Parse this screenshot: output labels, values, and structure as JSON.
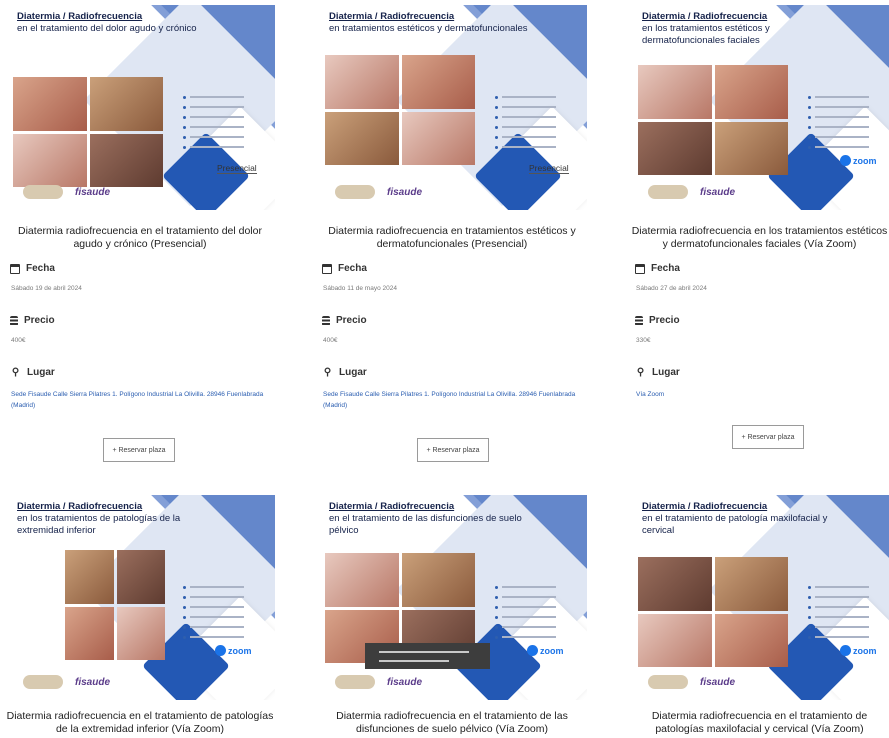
{
  "labels": {
    "fecha": "Fecha",
    "precio": "Precio",
    "lugar": "Lugar",
    "reservar": "+ Reservar plaza"
  },
  "cards": [
    {
      "banner_title": "Diatermia / Radiofrecuencia",
      "banner_sub": "en el tratamiento del dolor agudo y crónico",
      "banner_mode": "Presencial",
      "title": "Diatermia radiofrecuencia en el tratamiento del dolor agudo y crónico (Presencial)",
      "fecha": "Sábado 19 de abril 2024",
      "precio": "400€",
      "lugar": "Sede Fisaude Calle Sierra Pilatres 1. Polígono Industrial La Olivilla. 28946 Fuenlabrada (Madrid)"
    },
    {
      "banner_title": "Diatermia / Radiofrecuencia",
      "banner_sub": "en tratamientos estéticos y dermatofuncionales",
      "banner_mode": "Presencial",
      "title": "Diatermia radiofrecuencia en tratamientos estéticos y dermatofuncionales (Presencial)",
      "fecha": "Sábado 11 de mayo 2024",
      "precio": "400€",
      "lugar": "Sede Fisaude Calle Sierra Pilatres 1. Polígono Industrial La Olivilla. 28946 Fuenlabrada (Madrid)"
    },
    {
      "banner_title": "Diatermia / Radiofrecuencia",
      "banner_sub": "en los tratamientos estéticos y dermatofuncionales faciales",
      "banner_mode": "zoom",
      "title": "Diatermia radiofrecuencia en los tratamientos estéticos y dermatofuncionales faciales (Vía Zoom)",
      "fecha": "Sábado 27 de abril 2024",
      "precio": "330€",
      "lugar": "Vía Zoom"
    },
    {
      "banner_title": "Diatermia / Radiofrecuencia",
      "banner_sub": "en los tratamientos de patologías de la extremidad inferior",
      "banner_mode": "zoom",
      "title": "Diatermia radiofrecuencia en el tratamiento de patologías de la extremidad inferior (Vía Zoom)"
    },
    {
      "banner_title": "Diatermia / Radiofrecuencia",
      "banner_sub": "en el tratamiento de las disfunciones de suelo pélvico",
      "banner_mode": "zoom",
      "title": "Diatermia radiofrecuencia en el tratamiento de las disfunciones de suelo pélvico (Vía Zoom)"
    },
    {
      "banner_title": "Diatermia / Radiofrecuencia",
      "banner_sub": "en el tratamiento de patología maxilofacial y cervical",
      "banner_mode": "zoom",
      "title": "Diatermia radiofrecuencia en el tratamiento de patologías maxilofacial y cervical (Vía Zoom)"
    }
  ],
  "brand": {
    "logo_text": "fisaude",
    "accent": "#2f5fae",
    "link_color": "#2a5db0"
  }
}
